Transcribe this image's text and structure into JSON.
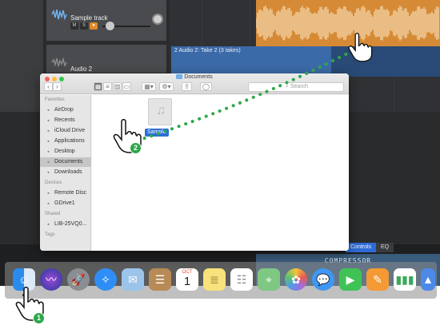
{
  "daw": {
    "track1_name": "Sample track",
    "track2_name": "Audio 2",
    "region2_label": "2  Audio 2: Take 2 (3 takes)",
    "tabs": {
      "controls": "Controls",
      "eq": "EQ"
    },
    "plugin_label": "COMPRESSOR"
  },
  "finder": {
    "window_title": "Documents",
    "search_placeholder": "Search",
    "sidebar": {
      "favorites_header": "Favorites",
      "favorites": [
        {
          "label": "AirDrop",
          "icon": "airdrop-icon"
        },
        {
          "label": "Recents",
          "icon": "recents-icon"
        },
        {
          "label": "iCloud Drive",
          "icon": "cloud-icon"
        },
        {
          "label": "Applications",
          "icon": "applications-icon"
        },
        {
          "label": "Desktop",
          "icon": "desktop-icon"
        },
        {
          "label": "Documents",
          "icon": "documents-icon",
          "selected": true
        },
        {
          "label": "Downloads",
          "icon": "downloads-icon"
        }
      ],
      "devices_header": "Devices",
      "devices": [
        {
          "label": "Remote Disc",
          "icon": "disc-icon"
        },
        {
          "label": "GDrive1",
          "icon": "drive-icon"
        }
      ],
      "shared_header": "Shared",
      "shared": [
        {
          "label": "LIB-25VQ0...",
          "icon": "computer-icon"
        }
      ],
      "tags_header": "Tags"
    },
    "file": {
      "name": "Sample",
      "icon": "music-note-icon"
    }
  },
  "dock": {
    "calendar_month": "OCT",
    "calendar_day": "1",
    "items": [
      "Finder",
      "Siri",
      "Launchpad",
      "Safari",
      "Mail",
      "Contacts",
      "Calendar",
      "Notes",
      "Reminders",
      "Maps",
      "Photos",
      "Messages",
      "FaceTime",
      "Pages",
      "Numbers",
      "Keynote"
    ]
  },
  "steps": {
    "one": "1",
    "two": "2"
  },
  "colors": {
    "audio_region": "#d68a35",
    "take_region": "#3b6aa8",
    "selection_blue": "#2d6fd6",
    "step_green": "#2ea84a",
    "drag_dots": "#2ea84a"
  }
}
